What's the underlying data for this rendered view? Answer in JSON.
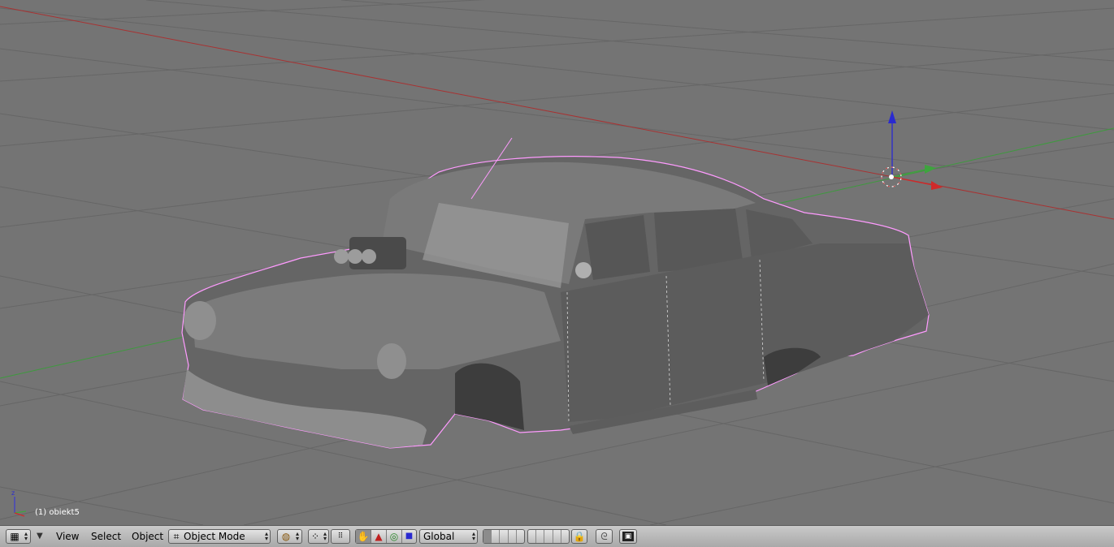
{
  "viewport": {
    "object_label": "(1) obiekt5",
    "colors": {
      "background": "#747474",
      "grid": "#646464",
      "x_axis": "#a83232",
      "y_axis": "#3e9a3e",
      "z_axis": "#2a2ad0",
      "selection_outline": "#ff9bff",
      "car_body": "#6b6b6b"
    }
  },
  "header": {
    "editor_type_icon": "grid-icon",
    "menus": {
      "view": "View",
      "select": "Select",
      "object": "Object"
    },
    "mode": {
      "icon": "object-mode-icon",
      "label": "Object Mode"
    },
    "shading_icon": "solid-shading-icon",
    "pivot_icon": "pivot-icon",
    "manipulator_icons": [
      "hand-icon",
      "translate-icon",
      "rotate-icon",
      "scale-icon"
    ],
    "orientation": "Global",
    "lock_icon": "lock-icon",
    "snap_icon": "snap-icon",
    "render_icon": "render-icon"
  }
}
